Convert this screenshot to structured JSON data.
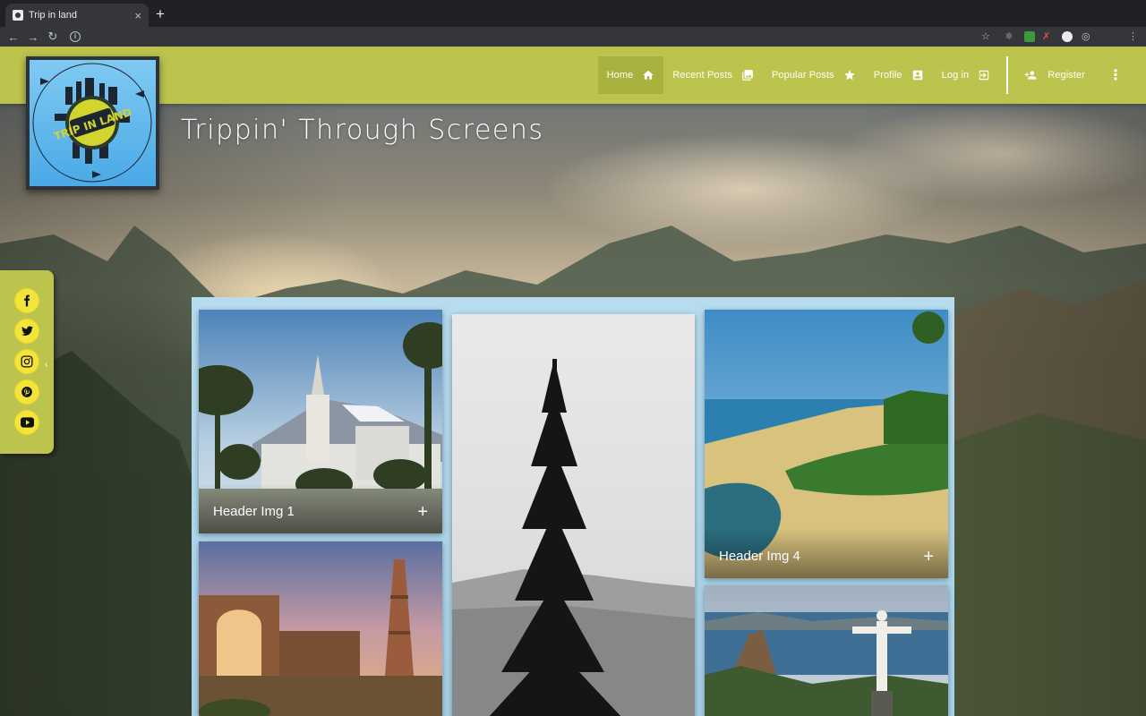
{
  "browser": {
    "tab_title": "Trip in land",
    "new_tab": "+",
    "tab_close": "×"
  },
  "site": {
    "title": "Trippin' Through Screens",
    "logo_text": "TRIP IN LAND"
  },
  "nav": {
    "items": [
      {
        "label": "Home",
        "icon": "home-icon",
        "active": true
      },
      {
        "label": "Recent Posts",
        "icon": "photo-library-icon",
        "active": false
      },
      {
        "label": "Popular Posts",
        "icon": "star-icon",
        "active": false
      },
      {
        "label": "Profile",
        "icon": "account-box-icon",
        "active": false
      },
      {
        "label": "Log in",
        "icon": "login-icon",
        "active": false
      },
      {
        "label": "Register",
        "icon": "person-add-icon",
        "active": false
      }
    ],
    "more": "⋮"
  },
  "social": {
    "items": [
      "facebook-icon",
      "twitter-icon",
      "instagram-icon",
      "pinterest-icon",
      "youtube-icon"
    ],
    "collapse": "‹"
  },
  "gallery": {
    "cards": [
      {
        "caption": "Header Img 1",
        "action": "+"
      },
      {
        "caption": "",
        "action": ""
      },
      {
        "caption": "Header Img 4",
        "action": "+"
      },
      {
        "caption": "",
        "action": ""
      },
      {
        "caption": "",
        "action": ""
      }
    ]
  },
  "colors": {
    "navbar": "#bcc44e",
    "navbar_active": "#a9b13f",
    "social_button": "#f2e43a",
    "gallery_bg": "#b7dcee"
  }
}
